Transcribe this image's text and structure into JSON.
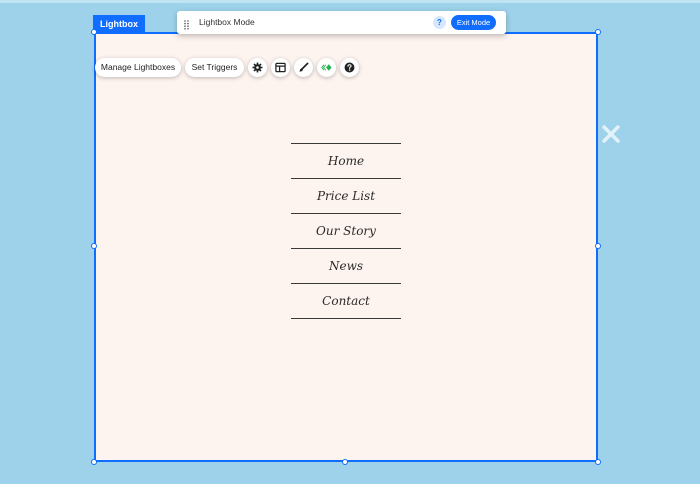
{
  "lightbox": {
    "tag": "Lightbox"
  },
  "mode_bar": {
    "title": "Lightbox Mode",
    "help": "?",
    "exit_label": "Exit Mode"
  },
  "toolbar": {
    "manage_label": "Manage Lightboxes",
    "triggers_label": "Set Triggers",
    "icons": [
      "gear-icon",
      "layout-icon",
      "design-brush-icon",
      "animation-icon",
      "help-icon"
    ]
  },
  "menu": {
    "items": [
      {
        "label": "Home"
      },
      {
        "label": "Price List"
      },
      {
        "label": "Our Story"
      },
      {
        "label": "News"
      },
      {
        "label": "Contact"
      }
    ]
  },
  "colors": {
    "canvas": "#9dd2ea",
    "lightbox_bg": "#fdf3ef",
    "accent": "#116dff",
    "animation_green": "#23b14d"
  }
}
